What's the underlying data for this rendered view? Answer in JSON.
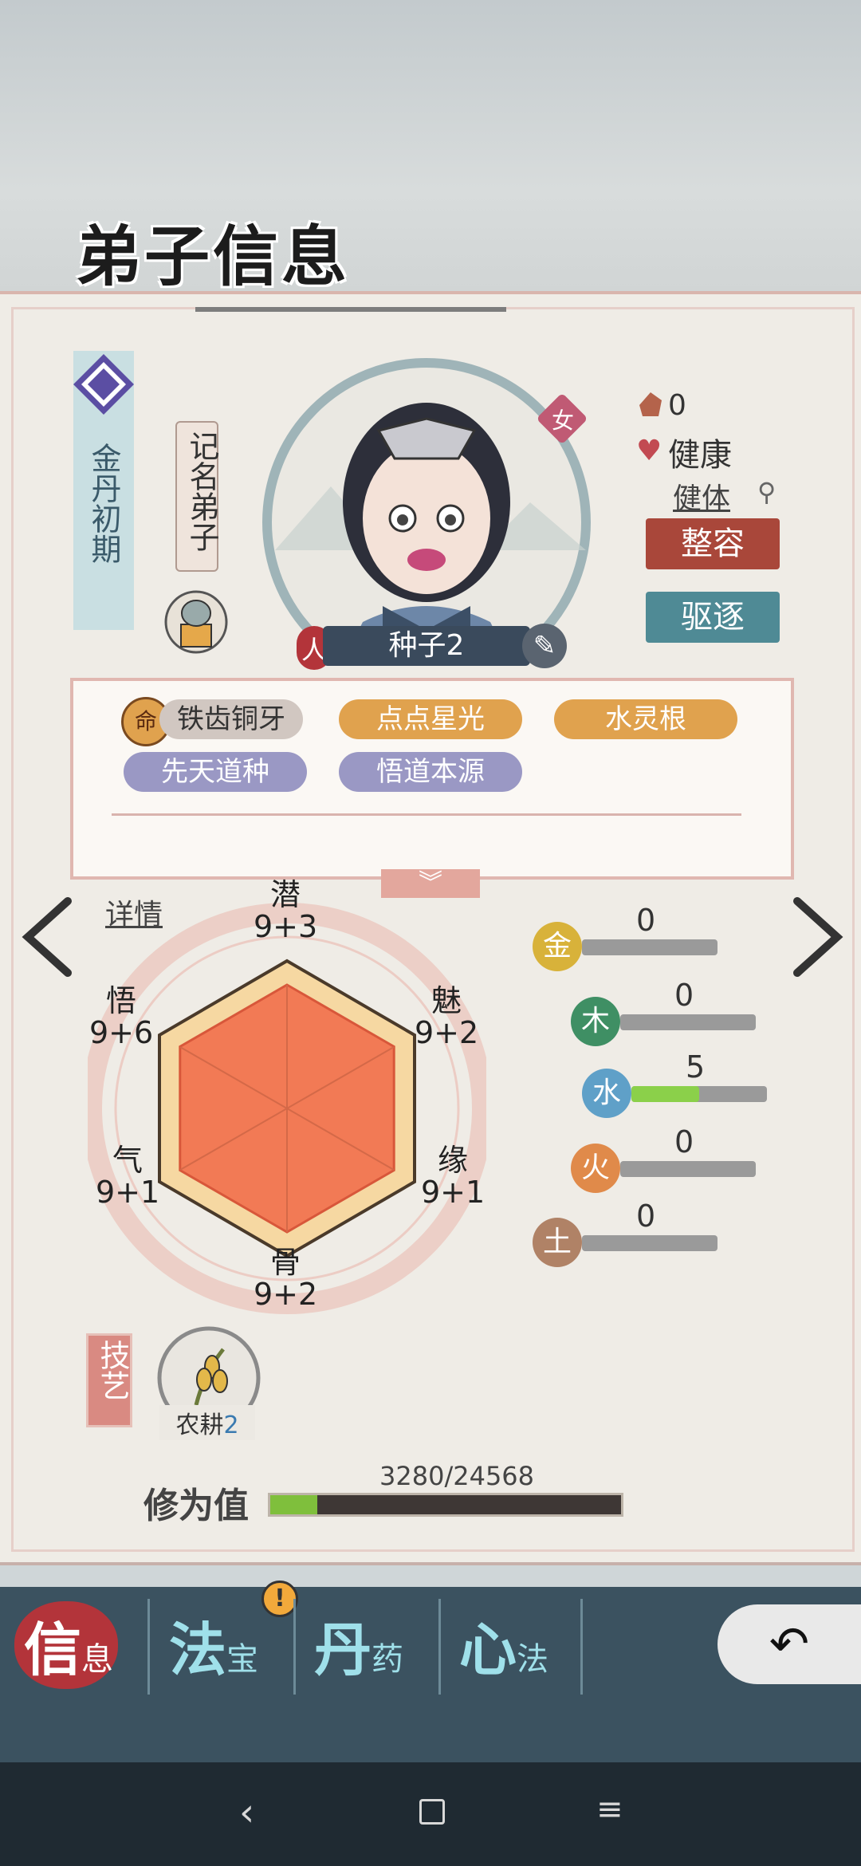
{
  "title": "弟子信息",
  "realm": "金丹初期",
  "rank": "记名弟子",
  "gender": "女",
  "race": "人",
  "name": "种子2",
  "stats_top": {
    "spirit_count": "0",
    "health": "健康",
    "constitution": "健体"
  },
  "buttons": {
    "makeover": "整容",
    "expel": "驱逐"
  },
  "traits": [
    "铁齿铜牙",
    "点点星光",
    "水灵根",
    "先天道种",
    "悟道本源"
  ],
  "trait_prefix_icon": "命",
  "details_link": "详情",
  "attributes": {
    "qian": {
      "label": "潜",
      "value": "9+3"
    },
    "mei": {
      "label": "魅",
      "value": "9+2"
    },
    "yuan": {
      "label": "缘",
      "value": "9+1"
    },
    "gu": {
      "label": "骨",
      "value": "9+2"
    },
    "qi": {
      "label": "气",
      "value": "9+1"
    },
    "wu": {
      "label": "悟",
      "value": "9+6"
    }
  },
  "elements": [
    {
      "icon": "金",
      "value": "0",
      "fill": 0,
      "color": "#d8b23a"
    },
    {
      "icon": "木",
      "value": "0",
      "fill": 0,
      "color": "#3f8f64"
    },
    {
      "icon": "水",
      "value": "5",
      "fill": 0.5,
      "color": "#5fa0c8"
    },
    {
      "icon": "火",
      "value": "0",
      "fill": 0,
      "color": "#e08a4a"
    },
    {
      "icon": "土",
      "value": "0",
      "fill": 0,
      "color": "#b08266"
    }
  ],
  "skills_label": "技艺",
  "skill": {
    "name": "农耕",
    "level": "2"
  },
  "cultivation": {
    "label": "修为值",
    "text": "3280/24568",
    "current": 3280,
    "max": 24568
  },
  "nav": [
    {
      "big": "信",
      "small": "息"
    },
    {
      "big": "法",
      "small": "宝"
    },
    {
      "big": "丹",
      "small": "药"
    },
    {
      "big": "心",
      "small": "法"
    }
  ],
  "nav_badge": "!",
  "colors": {
    "makeover": "#a9473a",
    "expel": "#4f8a95",
    "accent_red": "#b3343a"
  }
}
